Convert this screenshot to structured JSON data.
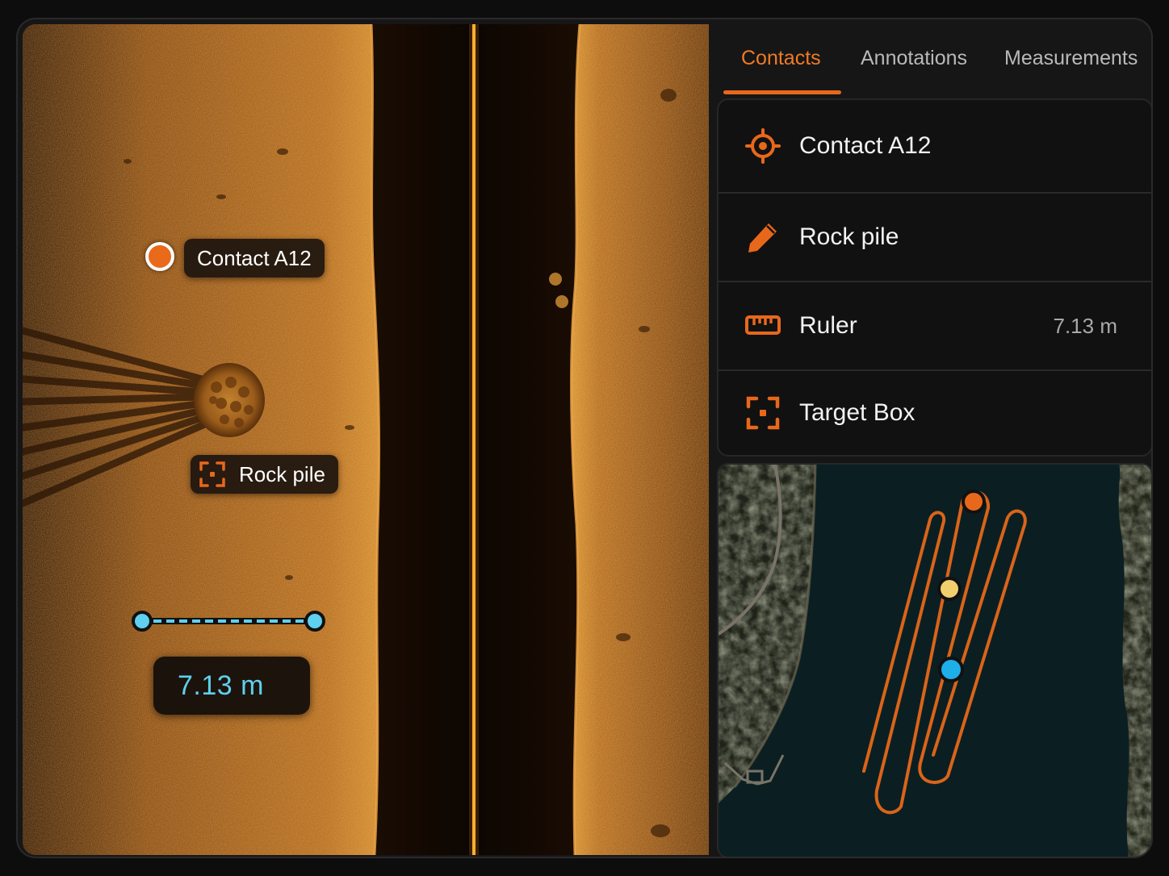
{
  "sonar": {
    "contact_label": "Contact A12",
    "rock_label": "Rock pile",
    "ruler_readout": "7.13 m"
  },
  "tabs": [
    {
      "label": "Contacts",
      "active": true
    },
    {
      "label": "Annotations",
      "active": false
    },
    {
      "label": "Measurements",
      "active": false
    }
  ],
  "list": {
    "items": [
      {
        "icon": "crosshair-icon",
        "name": "Contact A12",
        "value": ""
      },
      {
        "icon": "pencil-icon",
        "name": "Rock pile",
        "value": ""
      },
      {
        "icon": "ruler-icon",
        "name": "Ruler",
        "value": "7.13 m"
      },
      {
        "icon": "target-box-icon",
        "name": "Target Box",
        "value": ""
      }
    ]
  },
  "colors": {
    "accent": "#e8681b",
    "measure": "#5fd0ee",
    "sonar_sand": "#b26a1c",
    "track_marker_top": "#e8681b",
    "track_marker_mid": "#f2cf6e",
    "track_marker_low": "#1eaee8"
  }
}
